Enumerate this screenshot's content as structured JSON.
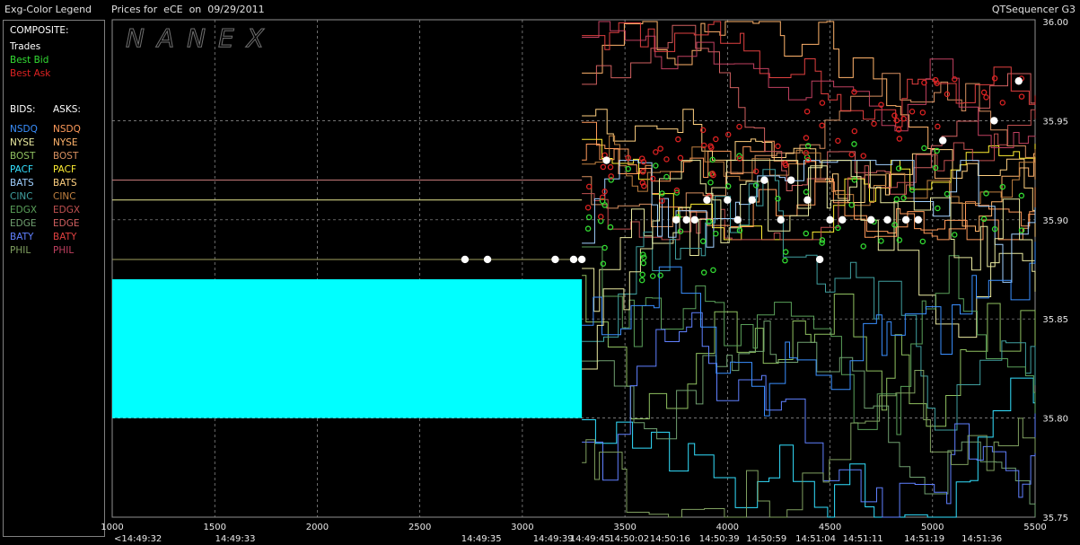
{
  "window": {
    "legend_title": "Exg-Color Legend",
    "chart_title": "Prices for  eCE  on  09/29/2011",
    "app_name": "QTSequencer G3"
  },
  "logo_text": "NANEX",
  "legend": {
    "composite_label": "COMPOSITE:",
    "composite": [
      {
        "label": "Trades",
        "color": "#ffffff"
      },
      {
        "label": "Best Bid",
        "color": "#33dd33"
      },
      {
        "label": "Best Ask",
        "color": "#dd2222"
      }
    ],
    "bids_label": "BIDS:",
    "asks_label": "ASKS:",
    "exchanges": [
      {
        "bid": "NSDQ",
        "ask": "NSDQ",
        "bid_color": "#3a8fff",
        "ask_color": "#ff9a5a"
      },
      {
        "bid": "NYSE",
        "ask": "NYSE",
        "bid_color": "#eaeaa0",
        "ask_color": "#ffb36b"
      },
      {
        "bid": "BOST",
        "ask": "BOST",
        "bid_color": "#8fc060",
        "ask_color": "#d89060"
      },
      {
        "bid": "PACF",
        "ask": "PACF",
        "bid_color": "#33e0ff",
        "ask_color": "#ffee33"
      },
      {
        "bid": "BATS",
        "ask": "BATS",
        "bid_color": "#a0d0ff",
        "ask_color": "#ffd080"
      },
      {
        "bid": "CINC",
        "ask": "CINC",
        "bid_color": "#40a0a0",
        "ask_color": "#c08040"
      },
      {
        "bid": "EDGX",
        "ask": "EDGX",
        "bid_color": "#5aa05a",
        "ask_color": "#c05050"
      },
      {
        "bid": "EDGE",
        "ask": "EDGE",
        "bid_color": "#70a070",
        "ask_color": "#d06060"
      },
      {
        "bid": "BATY",
        "ask": "BATY",
        "bid_color": "#6080ff",
        "ask_color": "#e04040"
      },
      {
        "bid": "PHIL",
        "ask": "PHIL",
        "bid_color": "#80a060",
        "ask_color": "#c04060"
      }
    ]
  },
  "chart_data": {
    "type": "line",
    "title": "Prices for  eCE  on  09/29/2011",
    "x_ticks": [
      1000,
      1500,
      2000,
      2500,
      3000,
      3500,
      4000,
      4500,
      5000,
      5500
    ],
    "xlim": [
      1000,
      5500
    ],
    "time_labels": [
      {
        "x": 1000,
        "label": "<14:49:32"
      },
      {
        "x": 1600,
        "label": "14:49:33"
      },
      {
        "x": 2800,
        "label": "14:49:35"
      },
      {
        "x": 3150,
        "label": "14:49:39"
      },
      {
        "x": 3330,
        "label": "14:49:45"
      },
      {
        "x": 3520,
        "label": "14:50:02"
      },
      {
        "x": 3720,
        "label": "14:50:16"
      },
      {
        "x": 3960,
        "label": "14:50:39"
      },
      {
        "x": 4190,
        "label": "14:50:59"
      },
      {
        "x": 4430,
        "label": "14:51:04"
      },
      {
        "x": 4660,
        "label": "14:51:11"
      },
      {
        "x": 4960,
        "label": "14:51:19"
      },
      {
        "x": 5240,
        "label": "14:51:36"
      }
    ],
    "y_ticks": [
      "36.00",
      "35.95",
      "35.90",
      "35.85",
      "35.80",
      "35.75"
    ],
    "ylim": [
      35.75,
      36.0
    ],
    "grid": true,
    "spread_block": {
      "x_start": 1000,
      "x_end": 3290,
      "y_low": 35.8,
      "y_high": 35.87,
      "color": "#00ffff"
    },
    "pre_lines": [
      {
        "y": 35.92,
        "x_end": 3290,
        "color": "#d08080"
      },
      {
        "y": 35.91,
        "x_end": 3290,
        "color": "#e8e890"
      },
      {
        "y": 35.88,
        "x_end": 3290,
        "color": "#a0a060"
      }
    ],
    "trades": [
      {
        "x": 2720,
        "y": 35.88
      },
      {
        "x": 2830,
        "y": 35.88
      },
      {
        "x": 3160,
        "y": 35.88
      },
      {
        "x": 3250,
        "y": 35.88
      },
      {
        "x": 3290,
        "y": 35.88
      },
      {
        "x": 3410,
        "y": 35.93
      },
      {
        "x": 3750,
        "y": 35.9
      },
      {
        "x": 3800,
        "y": 35.9
      },
      {
        "x": 3840,
        "y": 35.9
      },
      {
        "x": 3900,
        "y": 35.91
      },
      {
        "x": 4000,
        "y": 35.91
      },
      {
        "x": 4050,
        "y": 35.9
      },
      {
        "x": 4120,
        "y": 35.91
      },
      {
        "x": 4180,
        "y": 35.92
      },
      {
        "x": 4260,
        "y": 35.9
      },
      {
        "x": 4310,
        "y": 35.92
      },
      {
        "x": 4390,
        "y": 35.91
      },
      {
        "x": 4450,
        "y": 35.88
      },
      {
        "x": 4500,
        "y": 35.9
      },
      {
        "x": 4560,
        "y": 35.9
      },
      {
        "x": 4700,
        "y": 35.9
      },
      {
        "x": 4780,
        "y": 35.9
      },
      {
        "x": 4870,
        "y": 35.9
      },
      {
        "x": 4930,
        "y": 35.9
      },
      {
        "x": 5050,
        "y": 35.94
      },
      {
        "x": 5300,
        "y": 35.95
      },
      {
        "x": 5420,
        "y": 35.97
      }
    ]
  }
}
